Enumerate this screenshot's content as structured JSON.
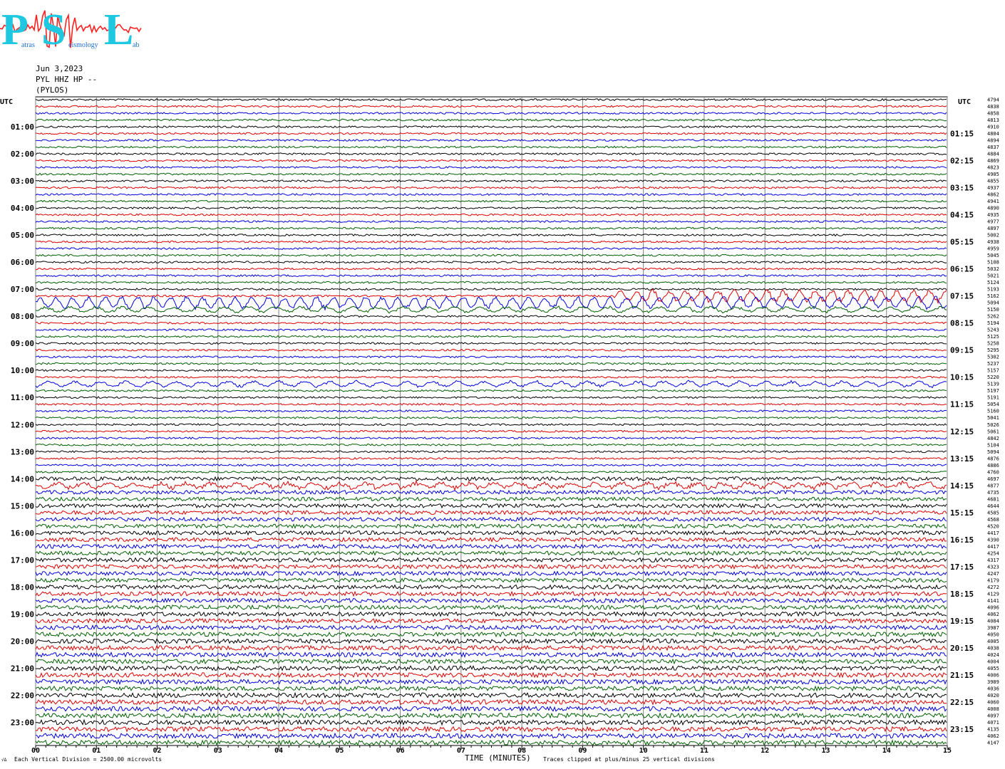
{
  "logo": {
    "letters": [
      "P",
      "S",
      "L"
    ],
    "words": [
      "atras",
      "eismology",
      "ab"
    ],
    "colors": {
      "letters": "#1ec8e0",
      "waveform": "#ff2020"
    }
  },
  "header": {
    "date": "Jun 3,2023",
    "station": "PYL HHZ HP --",
    "location": "(PYLOS)"
  },
  "chart_data": {
    "type": "helicorder",
    "left_axis_title": "UTC",
    "right_axis_title": "UTC",
    "hour_labels_left": [
      "01:00",
      "02:00",
      "03:00",
      "04:00",
      "05:00",
      "06:00",
      "07:00",
      "08:00",
      "09:00",
      "10:00",
      "11:00",
      "12:00",
      "13:00",
      "14:00",
      "15:00",
      "16:00",
      "17:00",
      "18:00",
      "19:00",
      "20:00",
      "21:00",
      "22:00",
      "23:00"
    ],
    "hour_labels_right": [
      "01:15",
      "02:15",
      "03:15",
      "04:15",
      "05:15",
      "06:15",
      "07:15",
      "08:15",
      "09:15",
      "10:15",
      "11:15",
      "12:15",
      "13:15",
      "14:15",
      "15:15",
      "16:15",
      "17:15",
      "18:15",
      "19:15",
      "20:15",
      "21:15",
      "22:15",
      "23:15"
    ],
    "x_ticks": [
      "00",
      "01",
      "02",
      "03",
      "04",
      "05",
      "06",
      "07",
      "08",
      "09",
      "10",
      "11",
      "12",
      "13",
      "14",
      "15"
    ],
    "xlabel": "TIME (MINUTES)",
    "trace_minutes": 15,
    "traces_per_hour": 4,
    "trace_count": 96,
    "trace_colors": [
      "#000000",
      "#e00000",
      "#0000e0",
      "#006000"
    ],
    "trace_values": [
      "4794",
      "4838",
      "4858",
      "4813",
      "4910",
      "4804",
      "4894",
      "4837",
      "4884",
      "4869",
      "4823",
      "4905",
      "4855",
      "4937",
      "4862",
      "4941",
      "4890",
      "4935",
      "4977",
      "4897",
      "5002",
      "4938",
      "4959",
      "5045",
      "5108",
      "5032",
      "5021",
      "5124",
      "5193",
      "5162",
      "5094",
      "5150",
      "5262",
      "5194",
      "5243",
      "5125",
      "5258",
      "5295",
      "5302",
      "5237",
      "5157",
      "5220",
      "5139",
      "5197",
      "5191",
      "5054",
      "5160",
      "5041",
      "5026",
      "5061",
      "4842",
      "5104",
      "5094",
      "4876",
      "4886",
      "4760",
      "4697",
      "4877",
      "4735",
      "4681",
      "4644",
      "4585",
      "4568",
      "4520",
      "4417",
      "4390",
      "4417",
      "4254",
      "4317",
      "4323",
      "4247",
      "4179",
      "4272",
      "4129",
      "4141",
      "4096",
      "4062",
      "4084",
      "3987",
      "4050",
      "4005",
      "4038",
      "4024",
      "4004",
      "4055",
      "4006",
      "3989",
      "4036",
      "4020",
      "4060",
      "4008",
      "4097",
      "4071",
      "4135",
      "4062",
      "4147"
    ],
    "events": [
      {
        "trace_index": 29,
        "start_min": 9.5,
        "end_min": 15,
        "amplitude": "high",
        "description_visible": "large red oscillation"
      },
      {
        "trace_index": 30,
        "start_min": 0,
        "end_min": 15,
        "amplitude": "high"
      },
      {
        "trace_index": 31,
        "start_min": 0,
        "end_min": 15,
        "amplitude": "medium"
      },
      {
        "trace_index": 42,
        "start_min": 0,
        "end_min": 15,
        "amplitude": "medium"
      },
      {
        "trace_index": 57,
        "start_min": 0,
        "end_min": 15,
        "amplitude": "medium"
      }
    ]
  },
  "footer": {
    "left": "Each Vertical Division = 2500.00 microvolts",
    "right": "Traces clipped at plus/minus 25 vertical divisions",
    "corner": "√Δ"
  }
}
